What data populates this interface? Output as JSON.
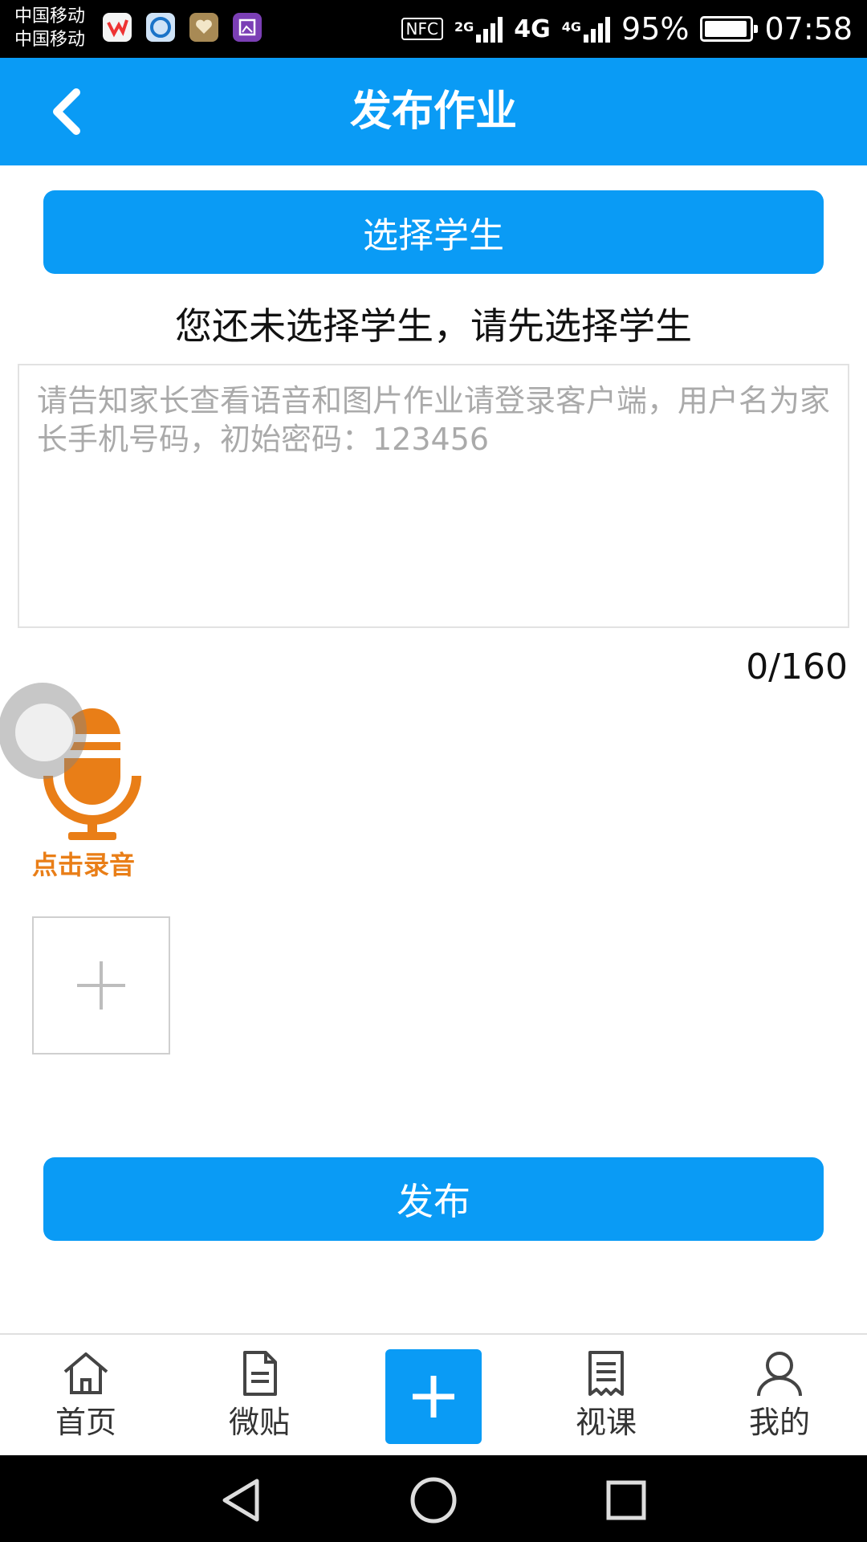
{
  "status_bar": {
    "carrier_1": "中国移动",
    "carrier_2": "中国移动",
    "nfc": "NFC",
    "net_2g": "2G",
    "net_4g_a": "4G",
    "net_4g_b": "4G",
    "battery": "95%",
    "battery_level": 0.95,
    "time": "07:58",
    "app_icons": [
      "app-icon-red",
      "app-icon-blue",
      "app-icon-gold",
      "app-icon-purple"
    ]
  },
  "header": {
    "title": "发布作业",
    "back_icon": "chevron-left-icon"
  },
  "content": {
    "select_students_label": "选择学生",
    "hint": "您还未选择学生，请先选择学生",
    "message_placeholder": "请告知家长查看语音和图片作业请登录客户端，用户名为家长手机号码，初始密码：123456",
    "message_value": "",
    "char_counter": "0/160",
    "record_label": "点击录音",
    "record_icon": "microphone-icon",
    "add_image_icon": "plus-icon",
    "publish_label": "发布"
  },
  "tabbar": {
    "items": [
      {
        "label": "首页",
        "icon": "home-icon"
      },
      {
        "label": "微贴",
        "icon": "document-icon"
      },
      {
        "label": "",
        "icon": "plus-icon"
      },
      {
        "label": "视课",
        "icon": "receipt-icon"
      },
      {
        "label": "我的",
        "icon": "user-icon"
      }
    ]
  },
  "colors": {
    "primary": "#0a9bf5",
    "record_orange": "#e97e17"
  },
  "navbar": {
    "back": "triangle-back-icon",
    "home": "circle-home-icon",
    "recents": "square-recents-icon"
  }
}
